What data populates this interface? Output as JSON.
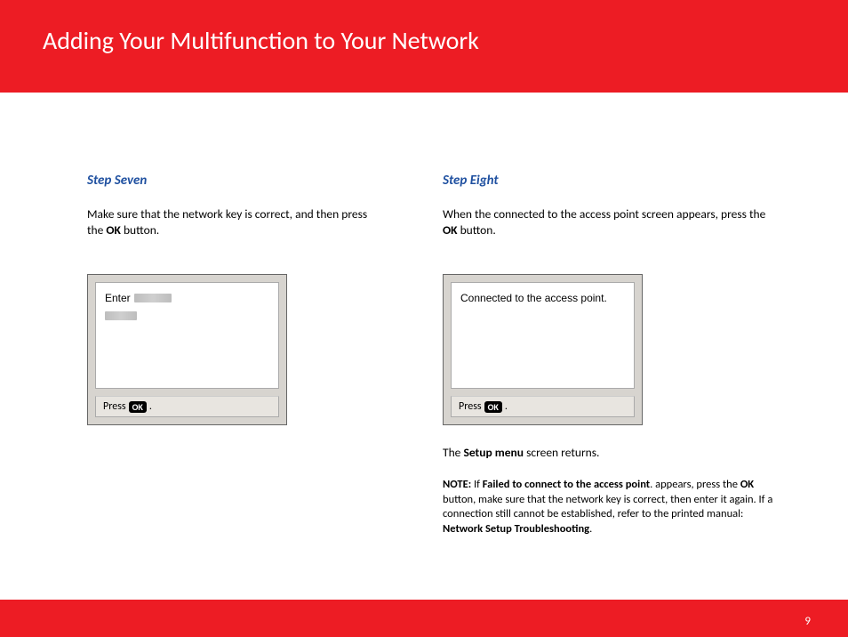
{
  "header": {
    "title": "Adding Your Multifunction to Your Network"
  },
  "step7": {
    "heading": "Step Seven",
    "text_before_bold": "Make sure that the network key is correct, and then press the ",
    "bold": "OK",
    "text_after_bold": " button.",
    "screen": {
      "enter_label": "Enter",
      "press_label": "Press",
      "ok_chip": "OK",
      "period": "."
    }
  },
  "step8": {
    "heading": "Step Eight",
    "text_before_bold": "When the connected to the access point  screen appears, press the ",
    "bold": "OK",
    "text_after_bold": " button.",
    "screen": {
      "message": "Connected to the access point.",
      "press_label": "Press",
      "ok_chip": "OK",
      "period": "."
    },
    "returns_before": "The ",
    "returns_bold": "Setup menu",
    "returns_after": "  screen returns.",
    "note": {
      "label": "NOTE:",
      "t1": "  If  ",
      "b1": "Failed to connect to the access point",
      "t2": ". appears, press the ",
      "b2": "OK",
      "t3": " button, make sure that the network key is correct, then enter it again. If a connection still cannot be established, refer to the printed manual: ",
      "b3": "Network Setup Troubleshooting",
      "t4": "."
    }
  },
  "footer": {
    "page": "9"
  }
}
